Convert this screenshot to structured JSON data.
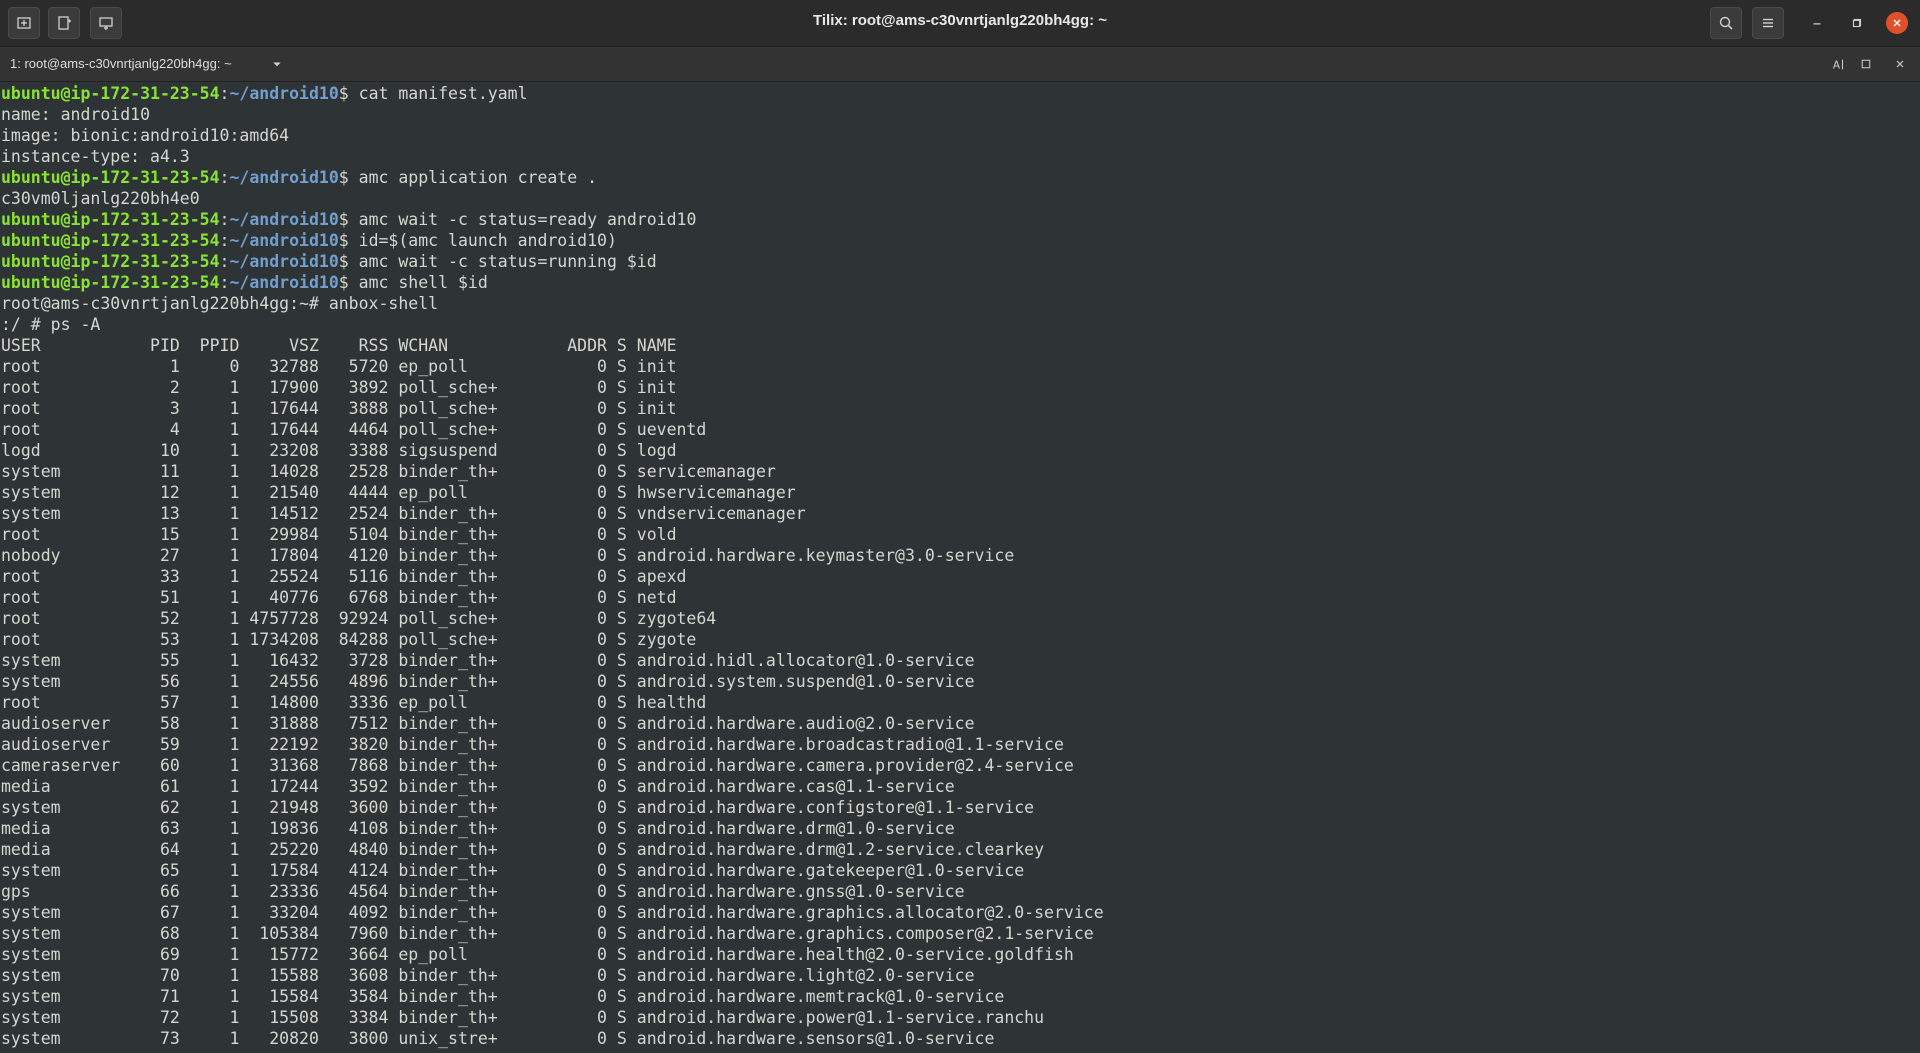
{
  "window": {
    "title": "Tilix: root@ams-c30vnrtjanlg220bh4gg: ~",
    "session_label": "1: root@ams-c30vnrtjanlg220bh4gg: ~"
  },
  "terminal": {
    "prompt_user": "ubuntu@ip-172-31-23-54",
    "prompt_path": "~/android10",
    "lines": [
      {
        "type": "prompt",
        "cmd": "cat manifest.yaml"
      },
      {
        "type": "out",
        "text": "name: android10"
      },
      {
        "type": "out",
        "text": "image: bionic:android10:amd64"
      },
      {
        "type": "out",
        "text": "instance-type: a4.3"
      },
      {
        "type": "prompt",
        "cmd": "amc application create ."
      },
      {
        "type": "out",
        "text": "c30vm0ljanlg220bh4e0"
      },
      {
        "type": "prompt",
        "cmd": "amc wait -c status=ready android10"
      },
      {
        "type": "prompt",
        "cmd": "id=$(amc launch android10)"
      },
      {
        "type": "prompt",
        "cmd": "amc wait -c status=running $id"
      },
      {
        "type": "prompt",
        "cmd": "amc shell $id"
      },
      {
        "type": "out",
        "text": "root@ams-c30vnrtjanlg220bh4gg:~# anbox-shell"
      },
      {
        "type": "out",
        "text": ":/ # ps -A"
      },
      {
        "type": "out",
        "text": "USER           PID  PPID     VSZ    RSS WCHAN            ADDR S NAME"
      },
      {
        "type": "out",
        "text": "root             1     0   32788   5720 ep_poll             0 S init"
      },
      {
        "type": "out",
        "text": "root             2     1   17900   3892 poll_sche+          0 S init"
      },
      {
        "type": "out",
        "text": "root             3     1   17644   3888 poll_sche+          0 S init"
      },
      {
        "type": "out",
        "text": "root             4     1   17644   4464 poll_sche+          0 S ueventd"
      },
      {
        "type": "out",
        "text": "logd            10     1   23208   3388 sigsuspend          0 S logd"
      },
      {
        "type": "out",
        "text": "system          11     1   14028   2528 binder_th+          0 S servicemanager"
      },
      {
        "type": "out",
        "text": "system          12     1   21540   4444 ep_poll             0 S hwservicemanager"
      },
      {
        "type": "out",
        "text": "system          13     1   14512   2524 binder_th+          0 S vndservicemanager"
      },
      {
        "type": "out",
        "text": "root            15     1   29984   5104 binder_th+          0 S vold"
      },
      {
        "type": "out",
        "text": "nobody          27     1   17804   4120 binder_th+          0 S android.hardware.keymaster@3.0-service"
      },
      {
        "type": "out",
        "text": "root            33     1   25524   5116 binder_th+          0 S apexd"
      },
      {
        "type": "out",
        "text": "root            51     1   40776   6768 binder_th+          0 S netd"
      },
      {
        "type": "out",
        "text": "root            52     1 4757728  92924 poll_sche+          0 S zygote64"
      },
      {
        "type": "out",
        "text": "root            53     1 1734208  84288 poll_sche+          0 S zygote"
      },
      {
        "type": "out",
        "text": "system          55     1   16432   3728 binder_th+          0 S android.hidl.allocator@1.0-service"
      },
      {
        "type": "out",
        "text": "system          56     1   24556   4896 binder_th+          0 S android.system.suspend@1.0-service"
      },
      {
        "type": "out",
        "text": "root            57     1   14800   3336 ep_poll             0 S healthd"
      },
      {
        "type": "out",
        "text": "audioserver     58     1   31888   7512 binder_th+          0 S android.hardware.audio@2.0-service"
      },
      {
        "type": "out",
        "text": "audioserver     59     1   22192   3820 binder_th+          0 S android.hardware.broadcastradio@1.1-service"
      },
      {
        "type": "out",
        "text": "cameraserver    60     1   31368   7868 binder_th+          0 S android.hardware.camera.provider@2.4-service"
      },
      {
        "type": "out",
        "text": "media           61     1   17244   3592 binder_th+          0 S android.hardware.cas@1.1-service"
      },
      {
        "type": "out",
        "text": "system          62     1   21948   3600 binder_th+          0 S android.hardware.configstore@1.1-service"
      },
      {
        "type": "out",
        "text": "media           63     1   19836   4108 binder_th+          0 S android.hardware.drm@1.0-service"
      },
      {
        "type": "out",
        "text": "media           64     1   25220   4840 binder_th+          0 S android.hardware.drm@1.2-service.clearkey"
      },
      {
        "type": "out",
        "text": "system          65     1   17584   4124 binder_th+          0 S android.hardware.gatekeeper@1.0-service"
      },
      {
        "type": "out",
        "text": "gps             66     1   23336   4564 binder_th+          0 S android.hardware.gnss@1.0-service"
      },
      {
        "type": "out",
        "text": "system          67     1   33204   4092 binder_th+          0 S android.hardware.graphics.allocator@2.0-service"
      },
      {
        "type": "out",
        "text": "system          68     1  105384   7960 binder_th+          0 S android.hardware.graphics.composer@2.1-service"
      },
      {
        "type": "out",
        "text": "system          69     1   15772   3664 ep_poll             0 S android.hardware.health@2.0-service.goldfish"
      },
      {
        "type": "out",
        "text": "system          70     1   15588   3608 binder_th+          0 S android.hardware.light@2.0-service"
      },
      {
        "type": "out",
        "text": "system          71     1   15584   3584 binder_th+          0 S android.hardware.memtrack@1.0-service"
      },
      {
        "type": "out",
        "text": "system          72     1   15508   3384 binder_th+          0 S android.hardware.power@1.1-service.ranchu"
      },
      {
        "type": "out",
        "text": "system          73     1   20820   3800 unix_stre+          0 S android.hardware.sensors@1.0-service"
      }
    ]
  }
}
